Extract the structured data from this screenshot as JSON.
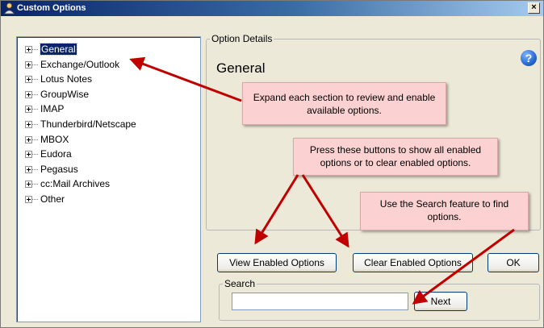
{
  "window": {
    "title": "Custom Options",
    "close_glyph": "×",
    "title_icon": "person-icon"
  },
  "tree": {
    "items": [
      {
        "label": "General",
        "selected": true
      },
      {
        "label": "Exchange/Outlook",
        "selected": false
      },
      {
        "label": "Lotus Notes",
        "selected": false
      },
      {
        "label": "GroupWise",
        "selected": false
      },
      {
        "label": "IMAP",
        "selected": false
      },
      {
        "label": "Thunderbird/Netscape",
        "selected": false
      },
      {
        "label": "MBOX",
        "selected": false
      },
      {
        "label": "Eudora",
        "selected": false
      },
      {
        "label": "Pegasus",
        "selected": false
      },
      {
        "label": "cc:Mail Archives",
        "selected": false
      },
      {
        "label": "Other",
        "selected": false
      }
    ]
  },
  "details": {
    "legend": "Option Details",
    "title": "General",
    "help_glyph": "?"
  },
  "buttons": {
    "view_enabled": "View Enabled Options",
    "clear_enabled": "Clear Enabled Options",
    "ok": "OK",
    "next": "Next"
  },
  "search": {
    "legend": "Search",
    "value": "",
    "placeholder": ""
  },
  "callouts": {
    "expand": "Expand each section to review and enable available options.",
    "buttons": "Press these buttons to show all enabled options or to clear enabled options.",
    "search": "Use the Search feature to find options."
  },
  "colors": {
    "callout_bg": "#fbd1d1",
    "arrow": "#c00000",
    "selection": "#0a246a"
  }
}
